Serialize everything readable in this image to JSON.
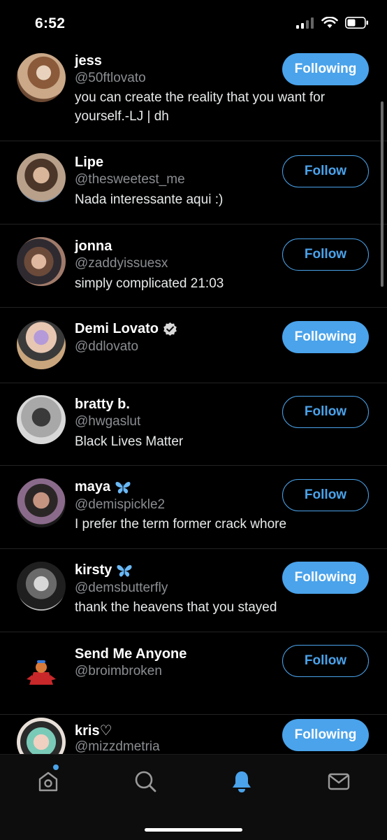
{
  "status": {
    "time": "6:52"
  },
  "accounts": [
    {
      "name": "jess",
      "handle": "@50ftlovato",
      "bio": "you can create the reality that you want for yourself.-LJ | dh",
      "button": "Following",
      "verified": false,
      "emoji": ""
    },
    {
      "name": "Lipe",
      "handle": "@thesweetest_me",
      "bio": "Nada interessante aqui :)",
      "button": "Follow",
      "verified": false,
      "emoji": ""
    },
    {
      "name": "jonna",
      "handle": "@zaddyissuesx",
      "bio": "simply complicated 21:03",
      "button": "Follow",
      "verified": false,
      "emoji": ""
    },
    {
      "name": "Demi Lovato",
      "handle": "@ddlovato",
      "bio": "",
      "button": "Following",
      "verified": true,
      "emoji": ""
    },
    {
      "name": "bratty b.",
      "handle": "@hwgaslut",
      "bio": "Black Lives Matter",
      "button": "Follow",
      "verified": false,
      "emoji": ""
    },
    {
      "name": "maya",
      "handle": "@demispickle2",
      "bio": "I prefer the term former crack whore",
      "button": "Follow",
      "verified": false,
      "emoji": "butterfly"
    },
    {
      "name": "kirsty",
      "handle": "@demsbutterfly",
      "bio": "thank the heavens that you stayed",
      "button": "Following",
      "verified": false,
      "emoji": "butterfly"
    },
    {
      "name": "Send Me Anyone",
      "handle": "@broimbroken",
      "bio": "",
      "button": "Follow",
      "verified": false,
      "emoji": ""
    },
    {
      "name": "kris♡",
      "handle": "@mizzdmetria",
      "bio": "",
      "button": "Following",
      "verified": false,
      "emoji": ""
    }
  ],
  "tabs": [
    "home-icon",
    "search-icon",
    "notifications-icon",
    "messages-icon"
  ],
  "colors": {
    "accent": "#4aa3eb",
    "background": "#000000",
    "secondary_text": "#8a8d91"
  }
}
